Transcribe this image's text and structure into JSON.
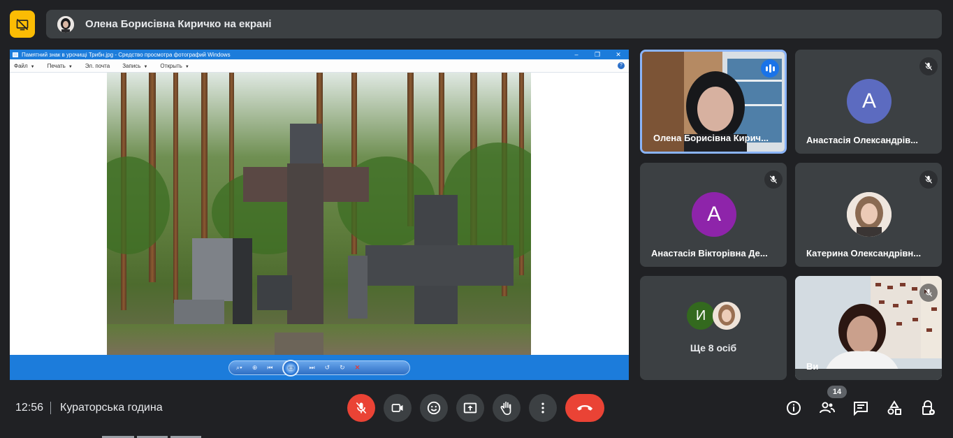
{
  "top_bar": {
    "presenter_banner": "Олена Борисівна Киричко на екрані"
  },
  "shared_window": {
    "title": "Памятний знак в урочищі Трибн.jpg - Средство просмотра фотографий Windows",
    "controls": [
      "–",
      "❐",
      "✕"
    ],
    "menu": [
      {
        "label": "Файл"
      },
      {
        "label": "Печать"
      },
      {
        "label": "Эл. почта"
      },
      {
        "label": "Запись"
      },
      {
        "label": "Открыть"
      }
    ],
    "help": "?"
  },
  "participants": [
    {
      "name": "Олена Борисівна Кирич...",
      "type": "video",
      "speaking": true
    },
    {
      "name": "Анастасія Олександрів...",
      "type": "avatar",
      "initial": "A",
      "color": "#5c6bc0",
      "muted": true
    },
    {
      "name": "Анастасія Вікторівна Де...",
      "type": "avatar",
      "initial": "A",
      "color": "#8e24aa",
      "muted": true
    },
    {
      "name": "Катерина Олександрівн...",
      "type": "photo-avatar",
      "muted": true
    },
    {
      "name": "Ще 8 осіб",
      "type": "group",
      "initial": "И",
      "color": "#33691e"
    },
    {
      "name": "Ви",
      "type": "video",
      "muted": true
    }
  ],
  "bottom_bar": {
    "time": "12:56",
    "meeting_title": "Кураторська година",
    "participant_count": "14"
  },
  "colors": {
    "accent_yellow": "#fbbc04",
    "end_call_red": "#ea4335",
    "speaking_blue": "#1a73e8",
    "panel_bg": "#3c4043",
    "page_bg": "#202124"
  },
  "icons": [
    "present-off-icon",
    "mic-off-icon",
    "camera-icon",
    "emoji-icon",
    "present-screen-icon",
    "raise-hand-icon",
    "more-options-icon",
    "end-call-icon",
    "info-icon",
    "people-icon",
    "chat-icon",
    "activities-icon",
    "host-controls-icon"
  ]
}
